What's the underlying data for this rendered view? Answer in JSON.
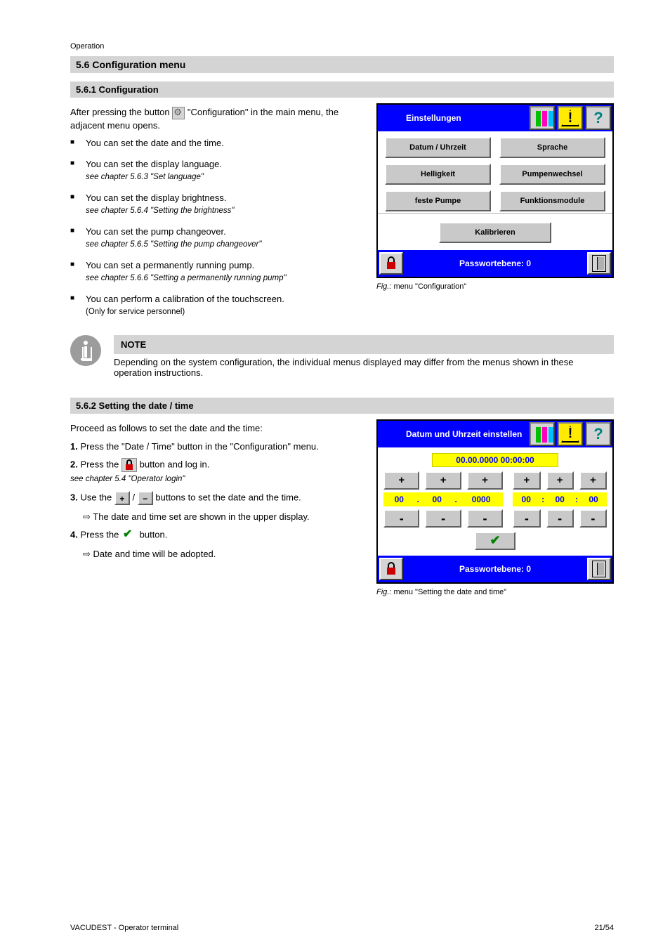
{
  "runningHeader": "Operation",
  "h2": "5.6 Configuration menu",
  "h3a": "5.6.1 Configuration",
  "introA_pre": "After pressing the button ",
  "introA_post": " \"Configuration\" in the main menu, the adjacent menu opens.",
  "bulletsA": [
    {
      "text": "You can set the date and the time."
    },
    {
      "text": "You can set the display language.",
      "sub": "see chapter 5.6.3 \"Set language\""
    },
    {
      "text": "You can set the display brightness.",
      "sub": "see chapter 5.6.4 \"Setting the brightness\""
    },
    {
      "text": "You can set the pump changeover.",
      "sub": "see chapter 5.6.5 \"Setting the pump changeover\""
    },
    {
      "text": "You can set a permanently running pump.",
      "sub": "see chapter 5.6.6 \"Setting a permanently running pump\""
    },
    {
      "text": "You can perform a calibration of the touchscreen.",
      "sub": "(Only for service personnel)"
    }
  ],
  "calloutTitle": "NOTE",
  "calloutBody": "Depending on the system configuration, the individual menus displayed may differ from the menus shown in these operation instructions.",
  "fig1": {
    "titlebarTitle": "Einstellungen",
    "buttons": {
      "dateTime": "Datum / Uhrzeit",
      "language": "Sprache",
      "brightness": "Helligkeit",
      "pumpChange": "Pumpenwechsel",
      "fixedPump": "feste Pumpe",
      "funcModules": "Funktionsmodule",
      "calibrate": "Kalibrieren"
    },
    "footerText": "Passwortebene: 0",
    "caption": "menu \"Configuration\""
  },
  "h3b": "5.6.2 Setting the date / time",
  "stepsBIntro": "Proceed as follows to set the date and the time:",
  "stepsB": [
    "Press the \"Date / Time\" button in the \"Configuration\" menu.",
    {
      "pre": "Press the ",
      "post": " button and log in.",
      "sub": "see chapter 5.4 \"Operator login\""
    },
    {
      "pre": "Use the ",
      "mid": " / ",
      "post": " buttons to set the date and the time."
    }
  ],
  "stepsBTip": "The date and time set are shown in the upper display.",
  "stepsB4_pre": "Press the ",
  "stepsB4_post": " button.",
  "stepsBDone": "Date and time will be adopted.",
  "fig2": {
    "titlebarTitle": "Datum und Uhrzeit einstellen",
    "display": "00.00.0000 00:00:00",
    "cells": {
      "d": "00",
      "m": "00",
      "y": "0000",
      "h": "00",
      "mi": "00",
      "s": "00"
    },
    "footerText": "Passwortebene: 0",
    "caption": "menu \"Setting the date and time\""
  },
  "figLabel": "Fig.:",
  "footerLeft": "VACUDEST - Operator terminal",
  "footerRight": "21/54"
}
